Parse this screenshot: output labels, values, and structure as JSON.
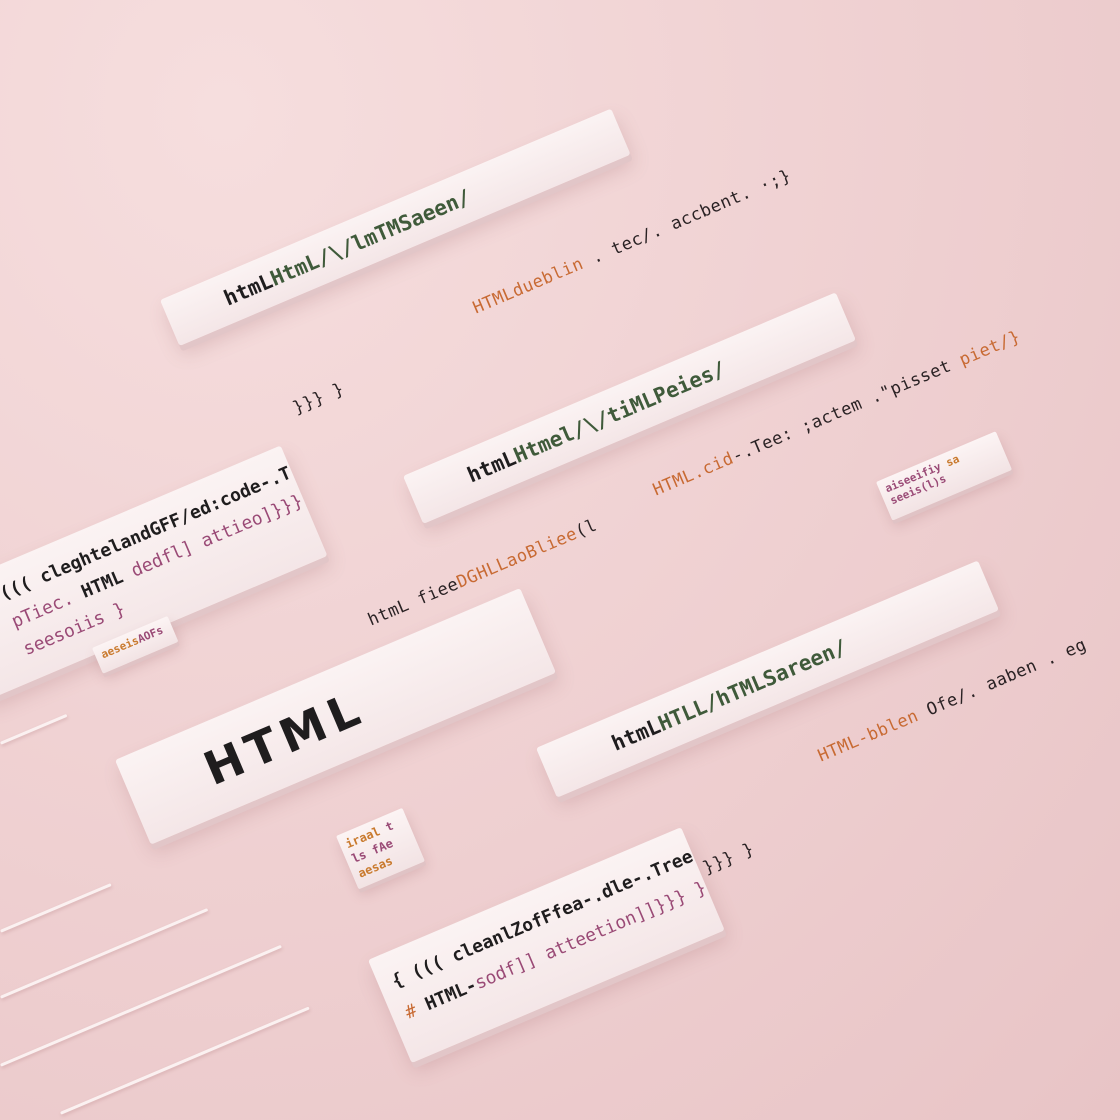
{
  "cards": {
    "card1": {
      "prefix": "htmL ",
      "rest": "HtmL/\\/lmTMSaeen/"
    },
    "card2": {
      "prefix": "htmL ",
      "rest": "Htmel/\\/tiMLPeies/"
    },
    "card3": {
      "prefix": "htmL ",
      "rest": "HTLL/hTMLSareen/"
    },
    "main": {
      "label": "HTML"
    },
    "left": {
      "line1a": "(((  ",
      "line1b": "cleghtelandGFF/ed:code-.Treek(l",
      "line2a": "pTiec. ",
      "line2b": "HTML ",
      "line2c": "dedfl] attieo]}}}}",
      "line3a": "seesoiis }"
    },
    "bottom": {
      "line1a": "{   ",
      "line1b": "(((  ",
      "line1c": "cleanlZofFfea-.dle-.Treek(l",
      "line2a": "# ",
      "line2b": "HTML-",
      "line2c": "sodf]] atteetion]]}}} }"
    }
  },
  "code_lines": {
    "l1a": "HTML",
    "l1b": "dueblin",
    "l1c": " . tec/. accbent. ·;}",
    "l2a": "}}} }",
    "l3a": "HTML",
    "l3b": ".cid",
    "l3c": "-.Tee: ;actem .\"pisset ",
    "l3d": "piet/}",
    "l4a": "htmL fiee",
    "l4b": "DGHLLaoBliee",
    "l4c": "(l ",
    "l5a": "HTML-bblen",
    "l5b": " Ofe/. aaben . eg",
    "l6a": "}}} }"
  },
  "chips": {
    "c1": {
      "a": "aiseeifiy ",
      "b": "sa",
      "c": "seeis(l)s"
    },
    "c2": {
      "a": "aeseis",
      "b": "AOFs"
    },
    "c3": {
      "a": "iraal ",
      "b": "t",
      "c": "ls fAe",
      "d": "aesas"
    }
  },
  "colors": {
    "background": "#f0d2d3",
    "card": "#fbf3f3",
    "text_dark": "#1f1d1e",
    "accent_orange": "#c86a33",
    "accent_purple": "#9a4a76",
    "accent_green": "#3f5a3a"
  }
}
